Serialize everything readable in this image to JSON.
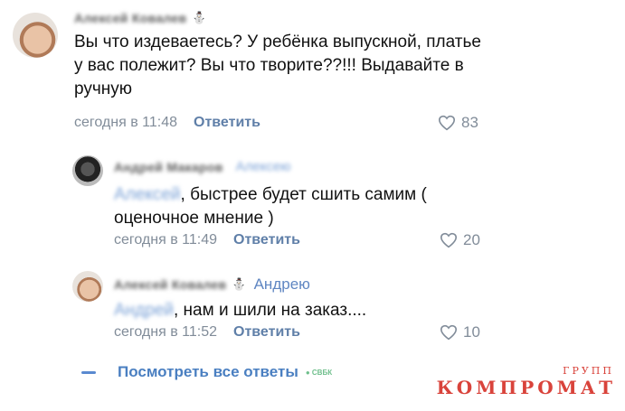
{
  "comments": [
    {
      "author": "Алексей Ковалев",
      "text": "Вы что издеваетесь? У ребёнка выпускной, платье у вас полежит? Вы что творите??!!! Выдавайте в ручную",
      "time": "сегодня в 11:48",
      "reply_label": "Ответить",
      "likes": "83"
    },
    {
      "author": "Андрей Макаров",
      "reply_target": "Алексею",
      "mention": "Алексей",
      "text": ", быстрее будет сшить самим ( оценочное мнение )",
      "time": "сегодня в 11:49",
      "reply_label": "Ответить",
      "likes": "20"
    },
    {
      "author": "Алексей Ковалев",
      "reply_target": "Андрею",
      "mention": "Андрей",
      "text": ", нам и шили на заказ....",
      "time": "сегодня в 11:52",
      "reply_label": "Ответить",
      "likes": "10"
    }
  ],
  "all_replies_label": "Посмотреть все ответы",
  "watermark": {
    "small": "ГРУПП",
    "main": "КОМПРОМАТ",
    "dot_text": "СВБК"
  },
  "colors": {
    "link": "#4a7fc1",
    "meta": "#818c99",
    "watermark": "#d9433b"
  }
}
